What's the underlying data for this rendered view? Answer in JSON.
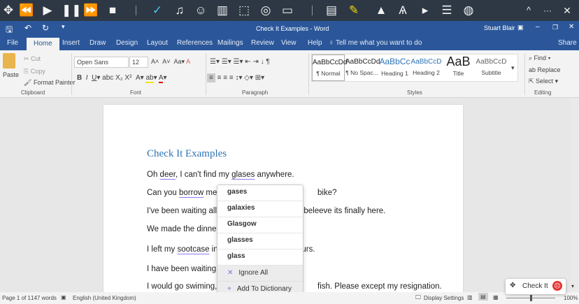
{
  "readwrite_toolbar": {
    "icons": [
      "move-icon",
      "rewind-icon",
      "play-icon",
      "pause-icon",
      "fast-forward-icon",
      "stop-icon",
      "check-it-icon",
      "hear-icon",
      "talk-icon",
      "dictionary-icon",
      "screenshot-reader-icon",
      "audio-maker-icon",
      "screen-mask-icon",
      "pdf-icon",
      "highlighter-icon",
      "collect-highlights-icon",
      "translator-icon",
      "video-maker-icon",
      "vocabulary-icon",
      "speech-maker-icon"
    ],
    "collapse": "^",
    "more": "···",
    "close": "✕"
  },
  "word": {
    "title": "Check It Examples - Word",
    "user": "Stuart Blair",
    "tabs": [
      "File",
      "Home",
      "Insert",
      "Draw",
      "Design",
      "Layout",
      "References",
      "Mailings",
      "Review",
      "View",
      "Help"
    ],
    "tell_me": "Tell me what you want to do",
    "share": "Share",
    "clipboard": {
      "paste": "Paste",
      "cut": "Cut",
      "copy": "Copy",
      "format_painter": "Format Painter",
      "label": "Clipboard"
    },
    "font": {
      "name": "Open Sans",
      "size": "12",
      "label": "Font"
    },
    "paragraph": {
      "label": "Paragraph"
    },
    "styles": {
      "items": [
        {
          "preview": "AaBbCcDd",
          "name": "¶ Normal"
        },
        {
          "preview": "AaBbCcDd",
          "name": "¶ No Spac..."
        },
        {
          "preview": "AaBbCc",
          "name": "Heading 1"
        },
        {
          "preview": "AaBbCcD",
          "name": "Heading 2"
        },
        {
          "preview": "AaB",
          "name": "Title"
        },
        {
          "preview": "AaBbCcD",
          "name": "Subtitle"
        }
      ],
      "label": "Styles"
    },
    "editing": {
      "find": "Find",
      "replace": "Replace",
      "select": "Select",
      "label": "Editing"
    }
  },
  "document": {
    "heading": "Check It Examples",
    "lines": [
      {
        "parts": [
          [
            "Oh ",
            0
          ],
          [
            "deer",
            1
          ],
          [
            ", I can't find my ",
            0
          ],
          [
            "glases",
            1
          ],
          [
            " anywhere.",
            0
          ]
        ]
      },
      {
        "parts": [
          [
            "Can you ",
            0
          ],
          [
            "borrow",
            1
          ],
          [
            " me y",
            0
          ]
        ],
        "right": "bike?"
      },
      {
        "parts": [
          [
            "I've been waiting all y",
            0
          ]
        ],
        "right": "t beleeve its finally here."
      },
      {
        "parts": [
          [
            "We made the dinner,",
            0
          ]
        ]
      },
      {
        "parts": [
          [
            "I left my ",
            0
          ],
          [
            "sootcase",
            1
          ],
          [
            " in t",
            0
          ]
        ],
        "right": "ours."
      },
      {
        "parts": [
          [
            "I have been waiting",
            0
          ]
        ]
      },
      {
        "parts": [
          [
            "I would go swiming, a",
            0
          ]
        ],
        "right": "fish. Please except my resignation."
      }
    ]
  },
  "popup": {
    "suggestions": [
      "gases",
      "galaxies",
      "Glasgow",
      "glasses",
      "glass"
    ],
    "ignore_all": "Ignore All",
    "add_to_dictionary": "Add To Dictionary"
  },
  "status": {
    "page": "Page 1 of 1",
    "words": "147 words",
    "language": "English (United Kingdom)",
    "display_settings": "Display Settings",
    "zoom": "100%"
  },
  "check_it": {
    "label": "Check It"
  },
  "colors": {
    "word_blue": "#2b579a",
    "toolbar": "#2d3844",
    "accent": "#7a6ee8",
    "heading": "#2e74b5"
  }
}
